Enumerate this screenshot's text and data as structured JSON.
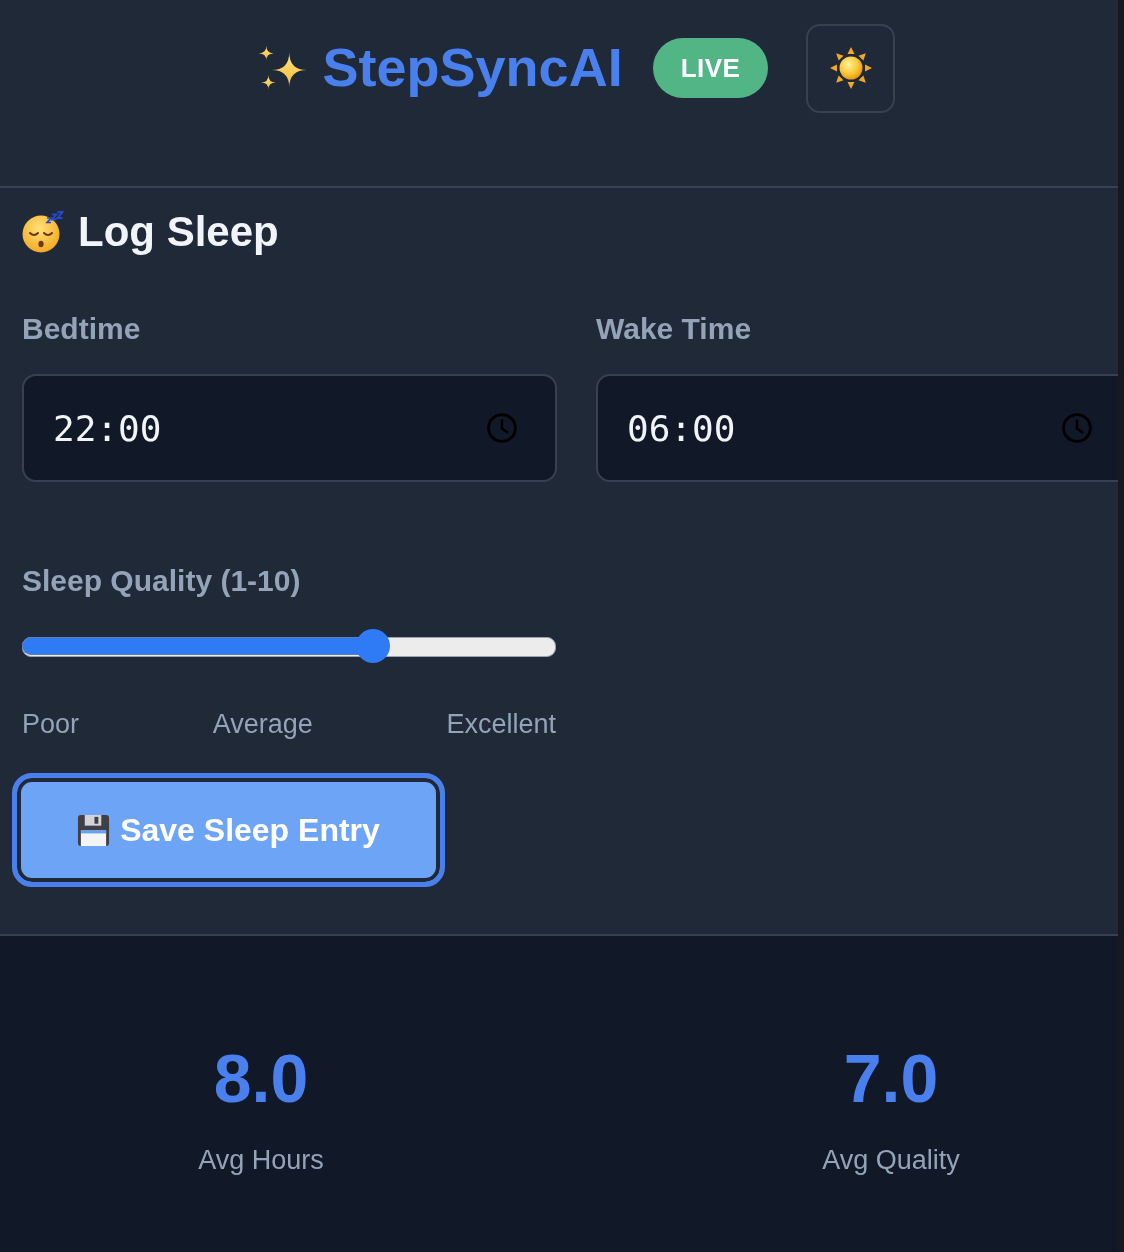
{
  "header": {
    "title": "StepSyncAI",
    "badge": "LIVE"
  },
  "log_sleep": {
    "title": "Log Sleep",
    "fields": [
      {
        "label": "Bedtime",
        "value": "22:00"
      },
      {
        "label": "Wake Time",
        "value": "06:00"
      }
    ],
    "quality": {
      "label": "Sleep Quality (1-10)",
      "level": 0.667,
      "scale_labels": [
        "Poor",
        "Average",
        "Excellent"
      ]
    },
    "save_button": {
      "label": "Save Sleep Entry",
      "focused": true
    }
  },
  "stats": [
    {
      "value": "8.0",
      "label": "Avg Hours"
    },
    {
      "value": "7.0",
      "label": "Avg Quality"
    }
  ]
}
